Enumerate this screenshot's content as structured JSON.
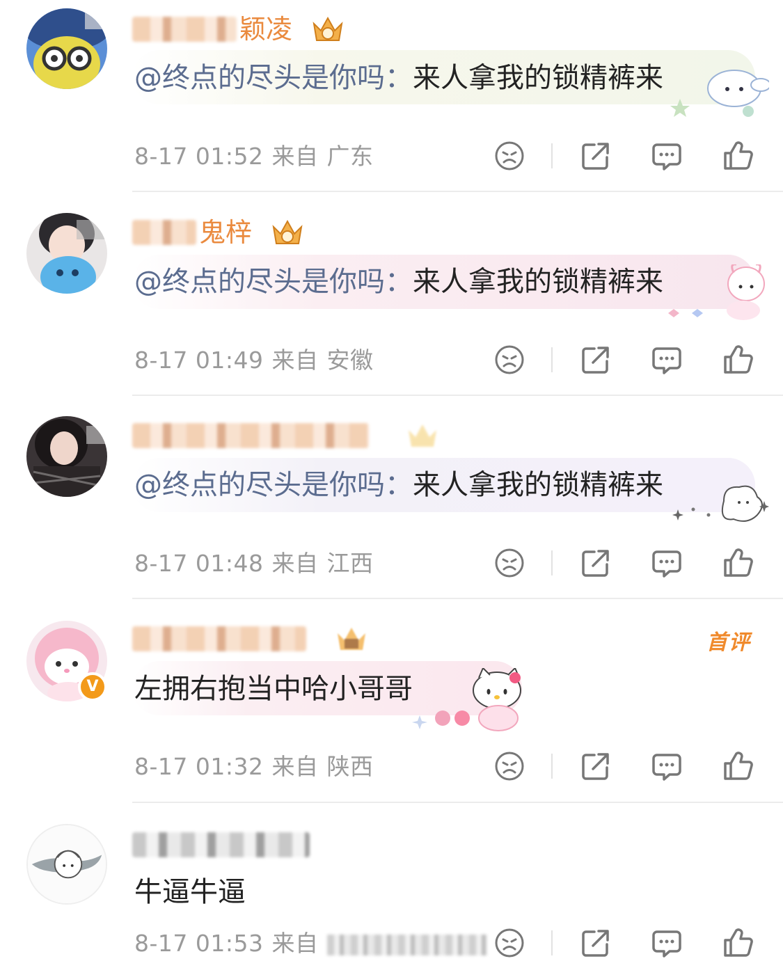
{
  "colors": {
    "mention": "#5b6c8f",
    "meta": "#9a9a9a",
    "username": "#e0823c",
    "hot_tag": "#f08a2c",
    "verified_badge": "#f39a1a"
  },
  "comments": [
    {
      "username_visible": "颖凌",
      "mention": "@终点的尽头是你吗：",
      "text": "来人拿我的锁精裤来",
      "time": "8-17 01:52",
      "from_label": "来自",
      "location": "广东"
    },
    {
      "username_visible": "鬼梓",
      "mention": "@终点的尽头是你吗：",
      "text": "来人拿我的锁精裤来",
      "time": "8-17 01:49",
      "from_label": "来自",
      "location": "安徽"
    },
    {
      "username_visible": "",
      "mention": "@终点的尽头是你吗：",
      "text": "来人拿我的锁精裤来",
      "time": "8-17 01:48",
      "from_label": "来自",
      "location": "江西"
    },
    {
      "username_visible": "",
      "mention": "",
      "text": "左拥右抱当中哈小哥哥",
      "time": "8-17 01:32",
      "from_label": "来自",
      "location": "陕西",
      "badge": "首评",
      "verified_mark": "V"
    },
    {
      "username_visible": "",
      "mention": "",
      "text": "牛逼牛逼",
      "time": "8-17 01:53",
      "from_label": "来自",
      "location": ""
    }
  ],
  "icons": [
    "dislike-face-icon",
    "share-icon",
    "comment-icon",
    "like-icon"
  ]
}
